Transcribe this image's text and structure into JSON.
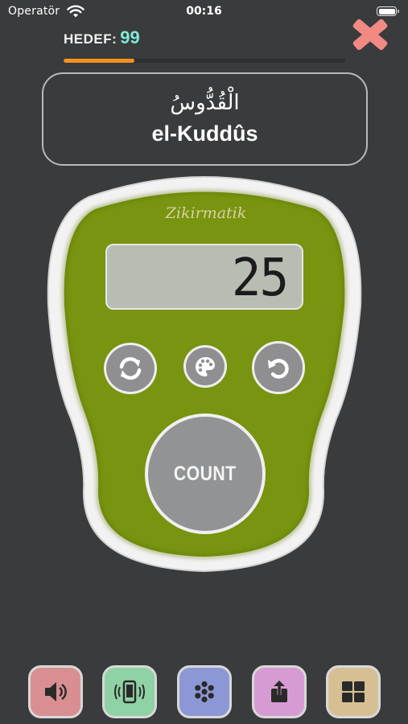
{
  "status_bar": {
    "carrier": "Operatör",
    "time": "00:16",
    "wifi_icon": "wifi-icon",
    "battery_icon": "battery-icon"
  },
  "target": {
    "label": "HEDEF:",
    "value": "99",
    "progress_fraction": 0.2525
  },
  "close_icon": "close-x-icon",
  "name": {
    "arabic": "الْقُدُّوسُ",
    "latin": "el-Kuddûs"
  },
  "counter": {
    "brand": "Zikirmatik",
    "count": "25",
    "reset_icon": "refresh-icon",
    "theme_icon": "palette-icon",
    "undo_icon": "undo-icon",
    "count_button_label": "COUNT"
  },
  "bottom_bar": [
    {
      "name": "sound-button",
      "icon": "speaker-icon",
      "color": "#d98f91"
    },
    {
      "name": "vibration-button",
      "icon": "vibrate-icon",
      "color": "#8fd2a5"
    },
    {
      "name": "beads-button",
      "icon": "beads-icon",
      "color": "#8c98d6"
    },
    {
      "name": "share-button",
      "icon": "share-icon",
      "color": "#d79bd3"
    },
    {
      "name": "menu-button",
      "icon": "grid-icon",
      "color": "#d6c093"
    }
  ],
  "colors": {
    "background": "#3a3b3d",
    "device_green": "#789410",
    "target_value": "#7fe8d3",
    "progress": "#f4931f",
    "close": "#f08a83"
  }
}
